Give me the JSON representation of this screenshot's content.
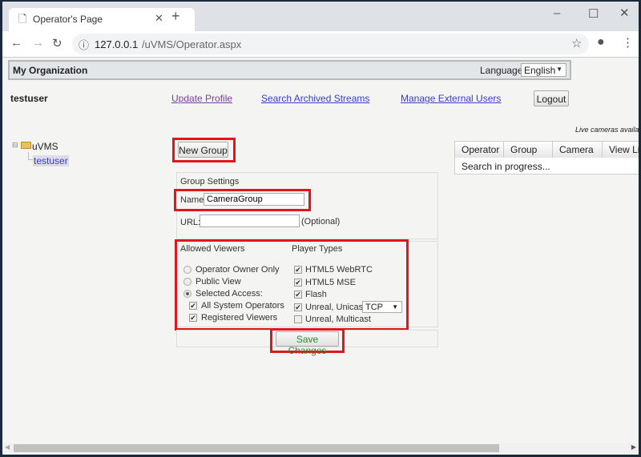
{
  "browser": {
    "tab_title": "Operator's Page",
    "url_host": "127.0.0.1",
    "url_path": "/uVMS/Operator.aspx"
  },
  "header": {
    "org": "My Organization",
    "language_label": "Language",
    "language_value": "English"
  },
  "userbar": {
    "username": "testuser",
    "links": [
      "Update Profile",
      "Search Archived Streams",
      "Manage External Users"
    ],
    "logout": "Logout"
  },
  "tree": {
    "root": "uVMS",
    "child": "testuser"
  },
  "new_group": "New Group",
  "group_settings": {
    "title": "Group Settings",
    "name_label": "Name:",
    "name_value": "CameraGroup",
    "url_label": "URL:",
    "url_value": "",
    "url_hint": "(Optional)"
  },
  "viewers": {
    "title": "Allowed Viewers",
    "options": [
      {
        "label": "Operator Owner Only",
        "selected": false
      },
      {
        "label": "Public View",
        "selected": false
      },
      {
        "label": "Selected Access:",
        "selected": true
      }
    ],
    "sub": [
      {
        "label": "All System Operators",
        "checked": true
      },
      {
        "label": "Registered Viewers",
        "checked": true
      }
    ]
  },
  "players": {
    "title": "Player Types",
    "items": [
      {
        "label": "HTML5 WebRTC",
        "checked": true
      },
      {
        "label": "HTML5 MSE",
        "checked": true
      },
      {
        "label": "Flash",
        "checked": true
      },
      {
        "label": "Unreal, Unicast",
        "checked": true
      },
      {
        "label": "Unreal, Multicast",
        "checked": false
      }
    ],
    "protocol": "TCP"
  },
  "save": "Save Changes",
  "cameras": {
    "note": "Live cameras available",
    "columns": [
      "Operator",
      "Group",
      "Camera",
      "View Live"
    ],
    "status": "Search in progress..."
  }
}
